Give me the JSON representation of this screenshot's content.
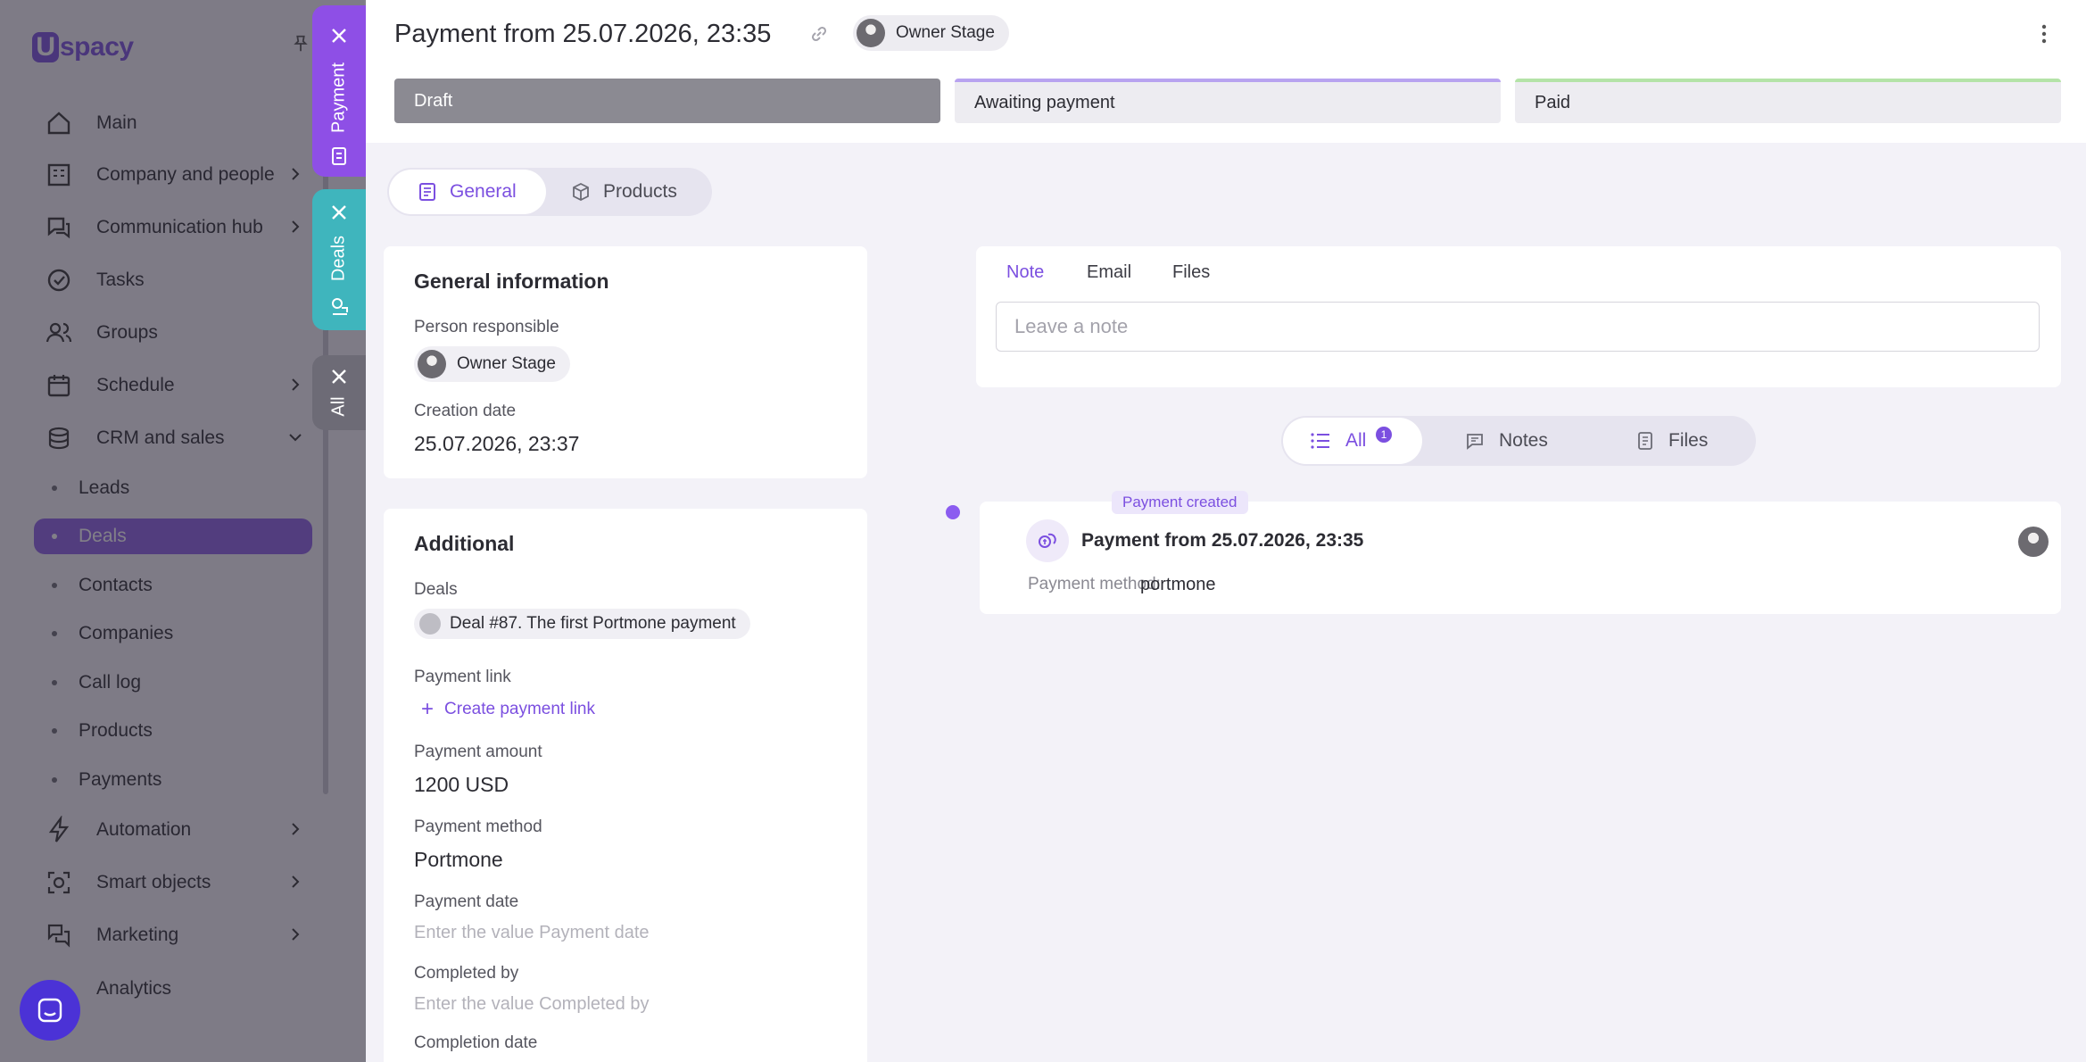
{
  "sidebar": {
    "logo": "Uspacy",
    "items": [
      {
        "label": "Main",
        "icon": "home-icon"
      },
      {
        "label": "Company and people",
        "icon": "company-icon"
      },
      {
        "label": "Communication hub",
        "icon": "communication-icon"
      },
      {
        "label": "Tasks",
        "icon": "tasks-icon"
      },
      {
        "label": "Groups",
        "icon": "groups-icon"
      },
      {
        "label": "Schedule",
        "icon": "calendar-icon"
      },
      {
        "label": "CRM and sales",
        "icon": "crm-icon"
      }
    ],
    "crm_sub": [
      {
        "label": "Leads"
      },
      {
        "label": "Deals"
      },
      {
        "label": "Contacts"
      },
      {
        "label": "Companies"
      },
      {
        "label": "Call log"
      },
      {
        "label": "Products"
      },
      {
        "label": "Payments"
      }
    ],
    "items_bottom": [
      {
        "label": "Automation",
        "icon": "automation-icon"
      },
      {
        "label": "Smart objects",
        "icon": "smart-objects-icon"
      },
      {
        "label": "Marketing",
        "icon": "marketing-icon"
      },
      {
        "label": "Analytics",
        "icon": "analytics-icon"
      }
    ]
  },
  "panel_tabs": {
    "payment": "Payment",
    "deals": "Deals",
    "all": "All"
  },
  "header": {
    "title": "Payment from 25.07.2026, 23:35",
    "owner": "Owner Stage",
    "stages": {
      "draft": "Draft",
      "awaiting": "Awaiting payment",
      "paid": "Paid"
    }
  },
  "view_tabs": {
    "general": "General",
    "products": "Products"
  },
  "general_info": {
    "title": "General information",
    "person_label": "Person responsible",
    "person_value": "Owner Stage",
    "creation_label": "Creation date",
    "creation_value": "25.07.2026, 23:37"
  },
  "additional": {
    "title": "Additional",
    "deals_label": "Deals",
    "deal_value": "Deal #87. The first Portmone payment",
    "payment_link_label": "Payment link",
    "create_link": "Create payment link",
    "amount_label": "Payment amount",
    "amount_value": "1200 USD",
    "method_label": "Payment method",
    "method_value": "Portmone",
    "date_label": "Payment date",
    "date_placeholder": "Enter the value Payment date",
    "completed_by_label": "Completed by",
    "completed_by_placeholder": "Enter the value Completed by",
    "completion_date_label": "Completion date"
  },
  "note_card": {
    "tabs": {
      "note": "Note",
      "email": "Email",
      "files": "Files"
    },
    "placeholder": "Leave a note"
  },
  "filter_tabs": {
    "all": "All",
    "all_count": "1",
    "notes": "Notes",
    "files": "Files"
  },
  "timeline_event": {
    "label": "Payment created",
    "title": "Payment from 25.07.2026, 23:35",
    "method_label": "Payment method:",
    "method_value": "portmone"
  },
  "colors": {
    "accent": "#7b4fe0",
    "payment_tab": "#8e4fe6",
    "deals_tab": "#3fb5bd",
    "draft_stage": "#8b8a92"
  }
}
